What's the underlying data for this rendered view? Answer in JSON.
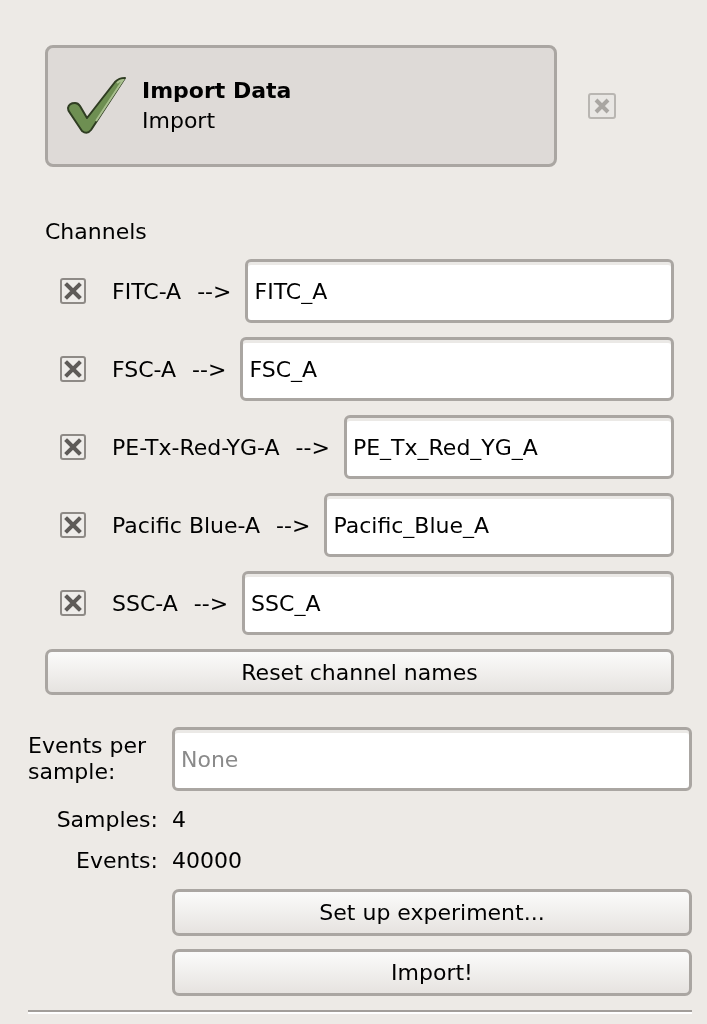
{
  "header": {
    "title": "Import Data",
    "subtitle": "Import"
  },
  "channels": {
    "label": "Channels",
    "items": [
      {
        "name": "FITC-A",
        "arrow": "-->",
        "value": "FITC_A",
        "checked": true
      },
      {
        "name": "FSC-A",
        "arrow": "-->",
        "value": "FSC_A",
        "checked": true
      },
      {
        "name": "PE-Tx-Red-YG-A",
        "arrow": "-->",
        "value": "PE_Tx_Red_YG_A",
        "checked": true
      },
      {
        "name": "Pacific Blue-A",
        "arrow": "-->",
        "value": "Pacific_Blue_A",
        "checked": true
      },
      {
        "name": "SSC-A",
        "arrow": "-->",
        "value": "SSC_A",
        "checked": true
      }
    ]
  },
  "reset_button": "Reset channel names",
  "events_per_sample": {
    "label": "Events per sample:",
    "placeholder": "None"
  },
  "stats": [
    {
      "label": "Samples:",
      "value": "4"
    },
    {
      "label": "Events:",
      "value": "40000"
    }
  ],
  "buttons": [
    "Set up experiment...",
    "Import!"
  ]
}
